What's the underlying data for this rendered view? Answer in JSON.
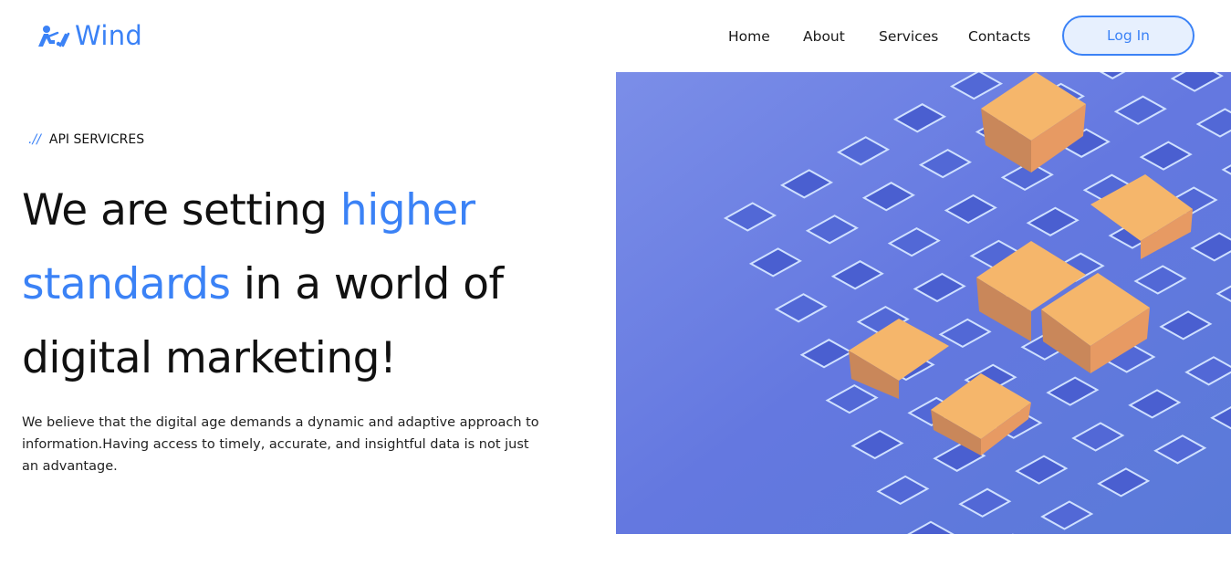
{
  "brand": {
    "name": "Wind",
    "logo_icon": "wind-logo-icon",
    "color": "#3b82f6"
  },
  "nav": {
    "items": [
      {
        "label": "Home"
      },
      {
        "label": "About"
      },
      {
        "label": "Services"
      },
      {
        "label": "Contacts"
      }
    ],
    "login_label": "Log In"
  },
  "hero": {
    "eyebrow_prefix": ".//",
    "eyebrow_text": "API SERVICRES",
    "headline_parts": {
      "part1": "We are setting ",
      "accent1": "higher",
      "accent2": "standards",
      "part2": " in a world of",
      "part3": "digital marketing!"
    },
    "description": "We believe that the digital age demands a dynamic and adaptive approach to information.Having access to timely, accurate, and insightful data is not just an advantage.",
    "image_subject": "isometric-houses-on-blue-grid-illustration",
    "accent_color": "#3b82f6",
    "image_bg_color": "#6b7fe0"
  }
}
